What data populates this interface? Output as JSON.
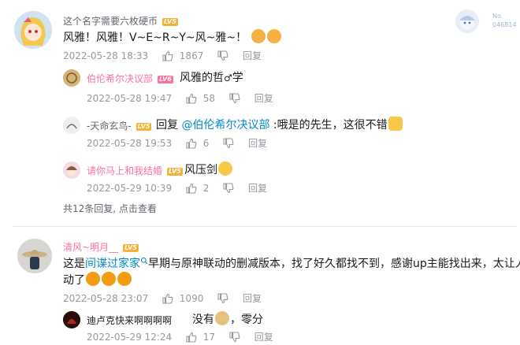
{
  "colors": {
    "text": "#18191c",
    "meta": "#9499a0",
    "link": "#008ac5",
    "vip_name": "#fb7299",
    "level_badge": "#f5b236"
  },
  "main_comment": {
    "user": "这个名字需要六枚硬币",
    "level": "LV5",
    "text": "风雅！风雅！V~E~R~Y~风~雅~！",
    "emojis": [
      "dog-face-emoji",
      "dog-face-emoji"
    ],
    "time": "2022-05-28 18:33",
    "likes": "1867",
    "reply_label": "回复",
    "fan_badge_label": "No.",
    "fan_badge_number": "046814"
  },
  "replies": [
    {
      "user": "伯伦希尔决议部",
      "level": "LV6",
      "text_before": "风雅的哲",
      "glyph": "♂",
      "text_after": "学",
      "time": "2022-05-28 19:47",
      "likes": "58",
      "reply_label": "回复"
    },
    {
      "user": "-天命玄鸟-",
      "level": "LV5",
      "prefix": "回复 ",
      "mention": "@伯伦希尔决议部",
      "text": " :哦是的先生，这很不错",
      "emoji": "thumbs-up-emoji",
      "time": "2022-05-28 19:53",
      "likes": "6",
      "reply_label": "回复"
    },
    {
      "user": "请你马上和我结婚",
      "level": "LV5",
      "text": "风压剑",
      "emoji": "grin-emoji",
      "time": "2022-05-29 10:39",
      "likes": "2",
      "reply_label": "回复"
    }
  ],
  "more_replies": "共12条回复, 点击查看",
  "second_comment": {
    "user": "清风~明月__",
    "level": "LV5",
    "text_before": "这是",
    "keyword": "间谍过家家",
    "text_after": "早期与原神联动的删减版本，找了好久都找不到，感谢up主能找出来，太让人感",
    "line2": "动了",
    "time": "2022-05-28 23:07",
    "likes": "1090",
    "reply_label": "回复"
  },
  "second_reply": {
    "user": "迪卢克快来啊啊啊啊",
    "text_before": "没有",
    "text_after": "，零分",
    "time": "2022-05-29 12:24",
    "likes": "17",
    "reply_label": "回复"
  }
}
